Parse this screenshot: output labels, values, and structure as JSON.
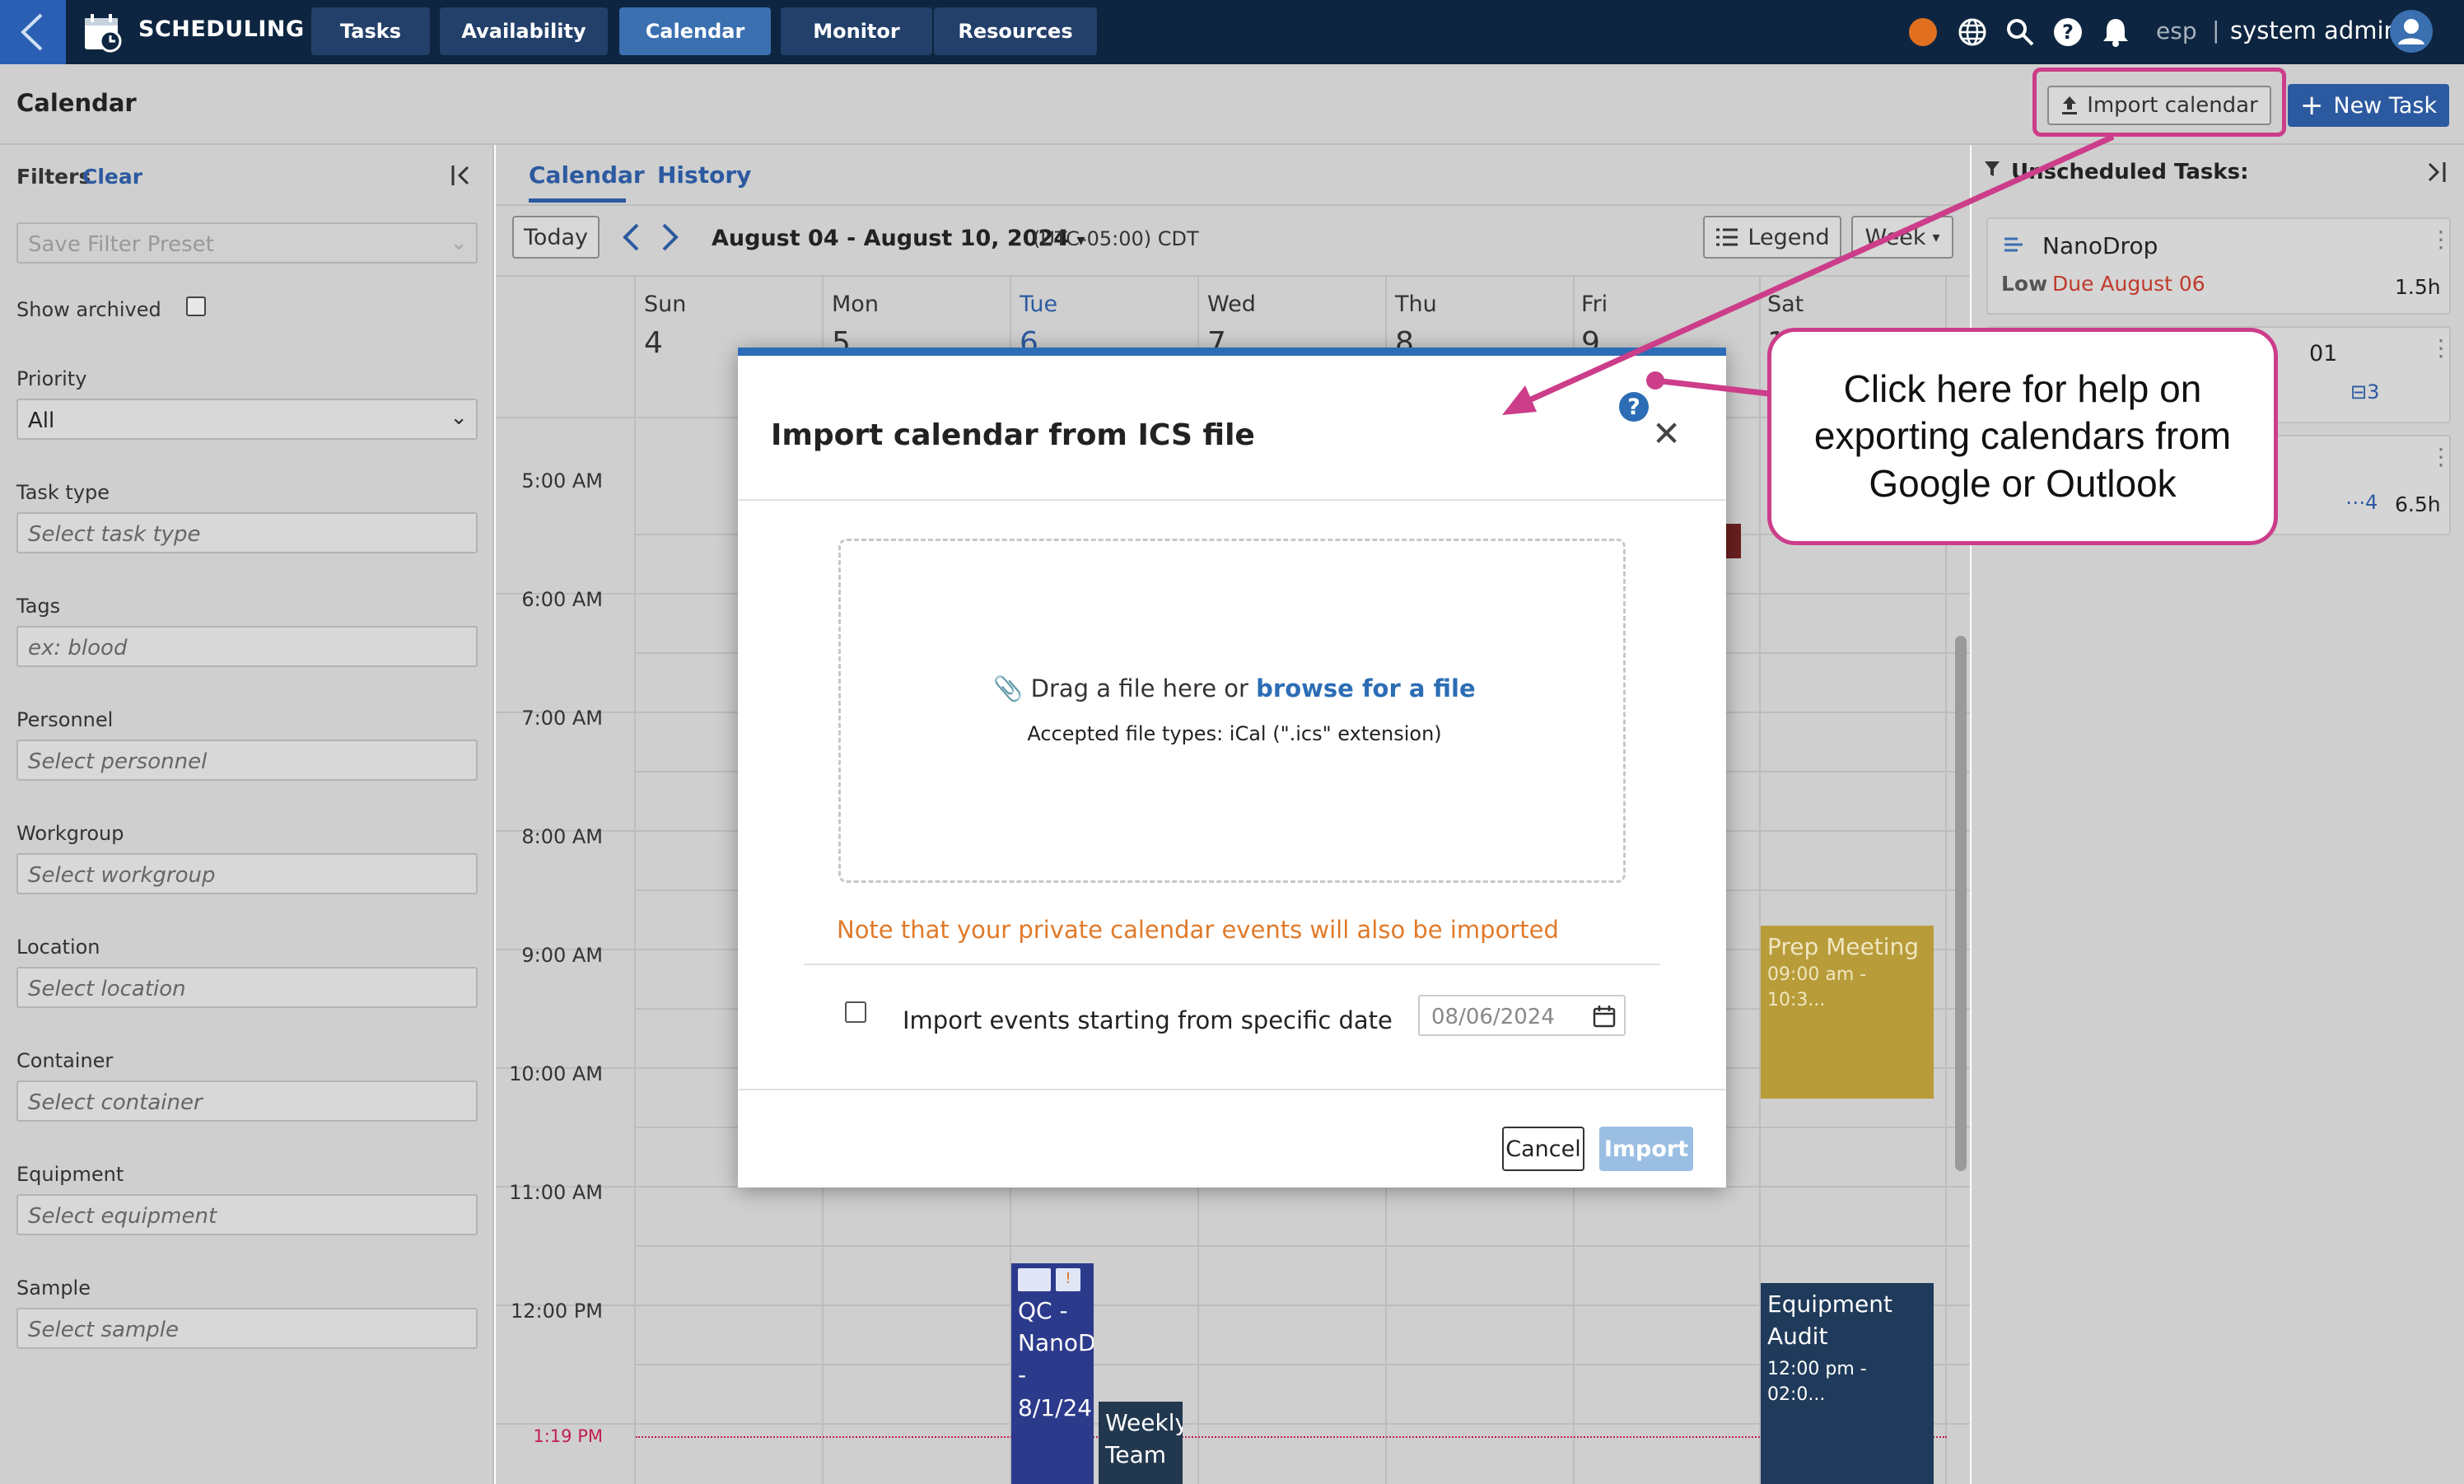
{
  "app": {
    "title": "SCHEDULING"
  },
  "nav": {
    "tabs": [
      {
        "label": "Tasks"
      },
      {
        "label": "Availability"
      },
      {
        "label": "Calendar"
      },
      {
        "label": "Monitor"
      },
      {
        "label": "Resources"
      }
    ]
  },
  "topbar": {
    "lang": "esp",
    "lang_sep": "|",
    "user": "system admin",
    "status_color": "#e07020"
  },
  "header": {
    "title": "Calendar",
    "import_label": "Import calendar",
    "new_task_label": "New Task"
  },
  "filters": {
    "title": "Filters",
    "clear": "Clear",
    "preset_placeholder": "Save Filter Preset",
    "show_archived": "Show archived",
    "priority_label": "Priority",
    "priority_value": "All",
    "fields": [
      {
        "label": "Task type",
        "placeholder": "Select task type"
      },
      {
        "label": "Tags",
        "placeholder": "ex: blood"
      },
      {
        "label": "Personnel",
        "placeholder": "Select personnel"
      },
      {
        "label": "Workgroup",
        "placeholder": "Select workgroup"
      },
      {
        "label": "Location",
        "placeholder": "Select location"
      },
      {
        "label": "Container",
        "placeholder": "Select container"
      },
      {
        "label": "Equipment",
        "placeholder": "Select equipment"
      },
      {
        "label": "Sample",
        "placeholder": "Select sample"
      }
    ]
  },
  "calendar": {
    "tabs": [
      "Calendar",
      "History"
    ],
    "today": "Today",
    "range": "August 04 - August 10, 2024",
    "timezone": "(UTC-05:00) CDT",
    "legend": "Legend",
    "view": "Week",
    "days": [
      {
        "name": "Sun",
        "num": "4"
      },
      {
        "name": "Mon",
        "num": "5"
      },
      {
        "name": "Tue",
        "num": "6"
      },
      {
        "name": "Wed",
        "num": "7"
      },
      {
        "name": "Thu",
        "num": "8"
      },
      {
        "name": "Fri",
        "num": "9"
      },
      {
        "name": "Sat",
        "num": "10"
      }
    ],
    "hours": [
      "5:00 AM",
      "6:00 AM",
      "7:00 AM",
      "8:00 AM",
      "9:00 AM",
      "10:00 AM",
      "11:00 AM",
      "12:00 PM"
    ],
    "now_label": "1:19 PM",
    "events": [
      {
        "title": "Prep Meeting",
        "time": "09:00 am - 10:3...",
        "color": "#b89c3a"
      },
      {
        "title": "Equipment Audit",
        "time": "12:00 pm - 02:0...",
        "color": "#1f3a5a"
      },
      {
        "title": "QC - NanoD - 8/1/24",
        "color": "#2c3a8c"
      },
      {
        "title": "Weekly Team",
        "color": "#22384f"
      }
    ]
  },
  "unscheduled": {
    "title": "Unscheduled Tasks:",
    "tasks": [
      {
        "name": "NanoDrop",
        "priority": "Low",
        "due": "Due August 06",
        "duration": "1.5h"
      },
      {
        "name": "01",
        "count": "3"
      },
      {
        "count": "4",
        "duration": "6.5h"
      }
    ]
  },
  "modal": {
    "title": "Import calendar from ICS file",
    "drop_text": "Drag a file here or",
    "browse_link": "browse for a file",
    "accepted": "Accepted file types: iCal (\".ics\" extension)",
    "private_note": "Note that your private calendar events will also be imported",
    "date_label": "Import events starting from specific date",
    "date_value": "08/06/2024",
    "cancel": "Cancel",
    "import": "Import"
  },
  "annotation": {
    "callout_text": "Click here for help on exporting calendars from Google or Outlook",
    "color": "#cc3d8a"
  }
}
